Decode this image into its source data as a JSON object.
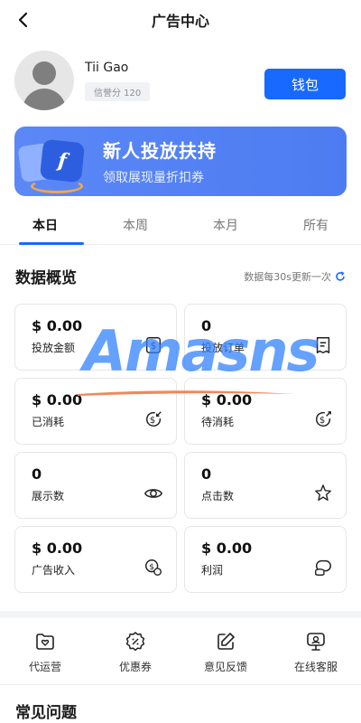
{
  "header": {
    "title": "广告中心",
    "back_icon": "chevron-left-icon"
  },
  "profile": {
    "name": "Tii Gao",
    "credit": "信誉分 120",
    "wallet_label": "钱包"
  },
  "banner": {
    "title": "新人投放扶持",
    "subtitle": "领取展现量折扣券"
  },
  "tabs": [
    {
      "label": "本日",
      "active": true
    },
    {
      "label": "本周",
      "active": false
    },
    {
      "label": "本月",
      "active": false
    },
    {
      "label": "所有",
      "active": false
    }
  ],
  "overview": {
    "title": "数据概览",
    "refresh_note": "数据每30s更新一次",
    "cards": [
      {
        "value": "$ 0.00",
        "label": "投放金额",
        "icon": "dollar-box-icon"
      },
      {
        "value": "0",
        "label": "投放订单",
        "icon": "order-icon"
      },
      {
        "value": "$ 0.00",
        "label": "已消耗",
        "icon": "consumed-icon"
      },
      {
        "value": "$ 0.00",
        "label": "待消耗",
        "icon": "pending-icon"
      },
      {
        "value": "0",
        "label": "展示数",
        "icon": "eye-icon"
      },
      {
        "value": "0",
        "label": "点击数",
        "icon": "click-star-icon"
      },
      {
        "value": "$ 0.00",
        "label": "广告收入",
        "icon": "coin-icon"
      },
      {
        "value": "$ 0.00",
        "label": "利润",
        "icon": "profit-icon"
      }
    ]
  },
  "shortcuts": [
    {
      "label": "代运营",
      "icon": "heart-folder-icon"
    },
    {
      "label": "优惠券",
      "icon": "coupon-icon"
    },
    {
      "label": "意见反馈",
      "icon": "feedback-edit-icon"
    },
    {
      "label": "在线客服",
      "icon": "support-icon"
    }
  ],
  "faq": {
    "title": "常见问题"
  },
  "watermark": {
    "text": "Amasns"
  },
  "colors": {
    "accent": "#1769ff",
    "banner": "#5b88f6"
  }
}
